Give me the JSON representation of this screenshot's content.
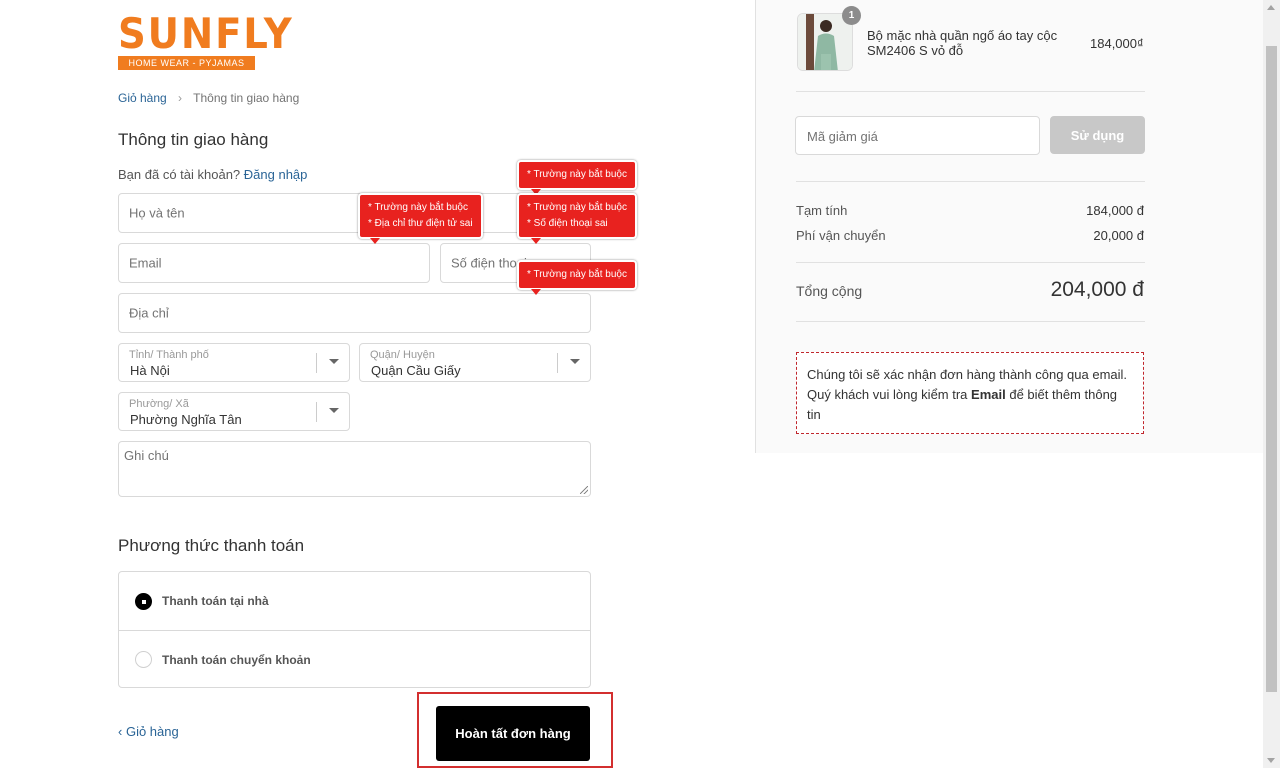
{
  "logo": {
    "brand": "SUNFLY",
    "tagline": "HOME WEAR - PYJAMAS"
  },
  "breadcrumb": {
    "cart": "Giỏ hàng",
    "current": "Thông tin giao hàng"
  },
  "shipping": {
    "title": "Thông tin giao hàng",
    "account_prompt": "Bạn đã có tài khoản?",
    "login_link": "Đăng nhập",
    "name_placeholder": "Họ và tên",
    "email_placeholder": "Email",
    "phone_placeholder": "Số điện thoại",
    "address_placeholder": "Địa chỉ",
    "province": {
      "label": "Tỉnh/ Thành phố",
      "value": "Hà Nội"
    },
    "district": {
      "label": "Quận/ Huyện",
      "value": "Quận Cầu Giấy"
    },
    "ward": {
      "label": "Phường/ Xã",
      "value": "Phường Nghĩa Tân"
    },
    "note_placeholder": "Ghi chú"
  },
  "validation": {
    "name_required": "* Trường này bắt buộc",
    "email_required": "* Trường này bắt buộc",
    "email_invalid": "* Địa chỉ thư điện tử sai",
    "phone_required": "* Trường này bắt buộc",
    "phone_invalid": "* Số điện thoại sai",
    "address_required": "* Trường này bắt buộc"
  },
  "payment": {
    "title": "Phương thức thanh toán",
    "options": [
      {
        "label": "Thanh toán tại nhà",
        "selected": true
      },
      {
        "label": "Thanh toán chuyển khoản",
        "selected": false
      }
    ]
  },
  "actions": {
    "back": "Giỏ hàng",
    "submit": "Hoàn tất đơn hàng"
  },
  "order": {
    "item": {
      "name": "Bộ mặc nhà quần ngố áo tay cộc SM2406 S vỏ đỗ",
      "price": "184,000₫",
      "quantity": "1"
    },
    "discount_placeholder": "Mã giảm giá",
    "apply_label": "Sử dụng",
    "subtotal_label": "Tạm tính",
    "subtotal_value": "184,000 đ",
    "shipping_label": "Phí vận chuyển",
    "shipping_value": "20,000 đ",
    "total_label": "Tổng cộng",
    "total_value": "204,000 đ",
    "notice_text": "Chúng tôi sẽ xác nhận đơn hàng thành công qua email. Quý khách vui lòng kiểm tra",
    "notice_bold": "Email",
    "notice_tail": "để biết thêm thông tin"
  },
  "colors": {
    "brand": "#f07c1f",
    "error": "#e8221f",
    "link": "#2a6496",
    "button": "#000000"
  }
}
